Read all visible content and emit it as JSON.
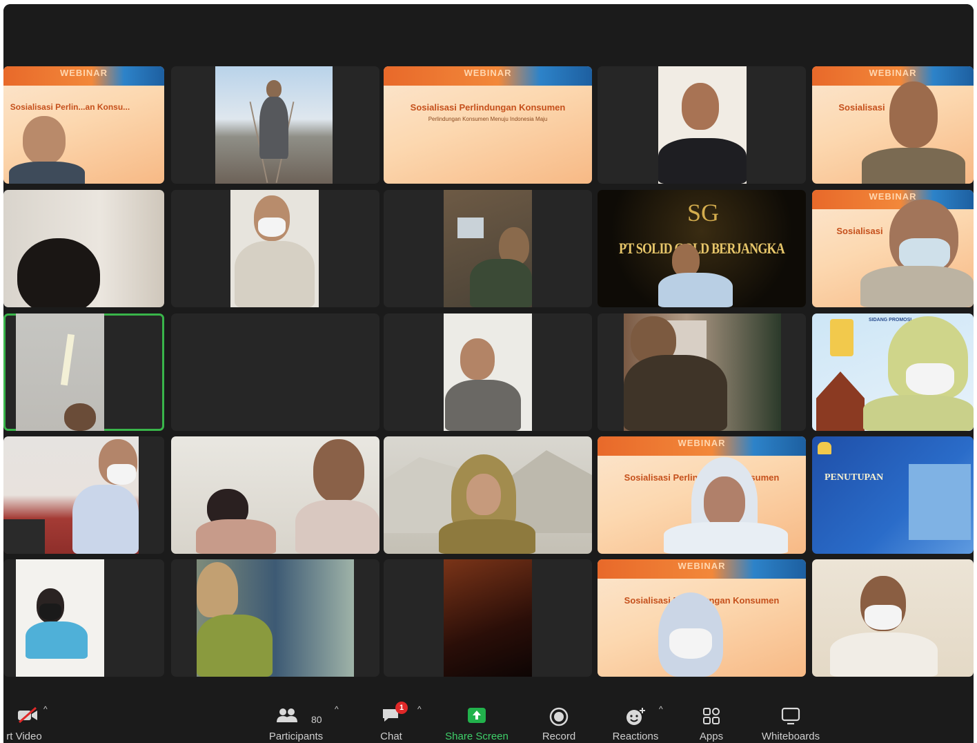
{
  "slides": {
    "webinar_band": "WEBINAR",
    "title": "Sosialisasi Perlindungan Konsumen",
    "subtitle": "Perlindungan Konsumen Menuju Indonesia Maju",
    "left_title_partial": "Sosialisasi Perlin...an Konsu...",
    "right_title_partial": "Sosialisasi",
    "right_sub_partial": "Perlin"
  },
  "gold_slide": {
    "logo": "SG",
    "title": "PT SOLID GOLD BERJANGKA"
  },
  "blue_slide": {
    "title": "PENUTUPAN"
  },
  "light_slide": {
    "title": "SIDANG PROMOSI"
  },
  "toolbar": {
    "start_video": "rt Video",
    "participants_count": "80",
    "participants": "Participants",
    "chat": "Chat",
    "chat_badge": "1",
    "share_screen": "Share Screen",
    "record": "Record",
    "reactions": "Reactions",
    "apps": "Apps",
    "whiteboards": "Whiteboards",
    "caret": "^"
  },
  "colors": {
    "window_bg": "#1b1b1b",
    "tile_bg": "#262626",
    "active_speaker": "#39b54a",
    "share_green": "#22b24c",
    "badge_red": "#e02828"
  }
}
